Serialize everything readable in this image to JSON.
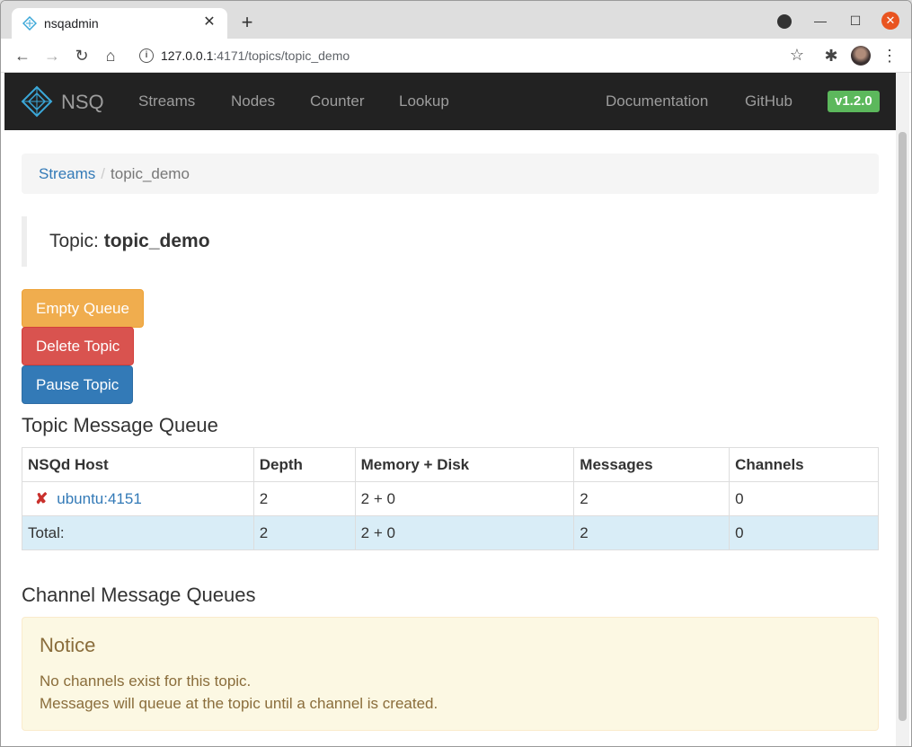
{
  "browser": {
    "tab_title": "nsqadmin",
    "url_host": "127.0.0.1",
    "url_rest": ":4171/topics/topic_demo",
    "new_tab_icon": "plus-icon",
    "close_tab_icon": "close-icon"
  },
  "navbar": {
    "brand": "NSQ",
    "links": [
      "Streams",
      "Nodes",
      "Counter",
      "Lookup"
    ],
    "right_links": [
      "Documentation",
      "GitHub"
    ],
    "version": "v1.2.0",
    "bg_color": "#222222",
    "version_color": "#5cb85c"
  },
  "breadcrumb": {
    "root": "Streams",
    "separator": "/",
    "current": "topic_demo"
  },
  "topic": {
    "label": "Topic:",
    "name": "topic_demo"
  },
  "actions": {
    "empty_queue": "Empty Queue",
    "delete_topic": "Delete Topic",
    "pause_topic": "Pause Topic"
  },
  "topic_queue": {
    "title": "Topic Message Queue",
    "columns": [
      "NSQd Host",
      "Depth",
      "Memory + Disk",
      "Messages",
      "Channels"
    ],
    "rows": [
      {
        "status_icon": "✘",
        "host": "ubuntu:4151",
        "depth": "2",
        "mem_disk": "2 + 0",
        "messages": "2",
        "channels": "0"
      }
    ],
    "total": {
      "label": "Total:",
      "depth": "2",
      "mem_disk": "2 + 0",
      "messages": "2",
      "channels": "0"
    }
  },
  "channel_queue": {
    "title": "Channel Message Queues",
    "notice_title": "Notice",
    "notice_lines": [
      "No channels exist for this topic.",
      "Messages will queue at the topic until a channel is created."
    ]
  }
}
